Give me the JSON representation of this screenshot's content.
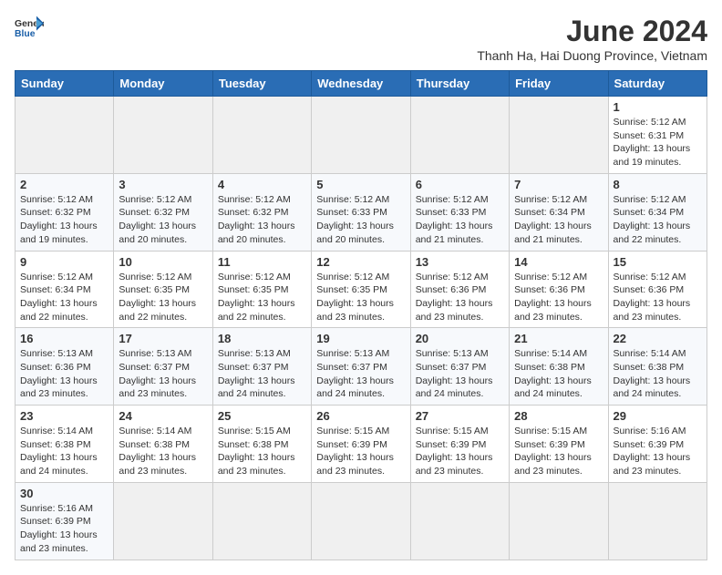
{
  "header": {
    "logo_general": "General",
    "logo_blue": "Blue",
    "month_year": "June 2024",
    "location": "Thanh Ha, Hai Duong Province, Vietnam"
  },
  "days_of_week": [
    "Sunday",
    "Monday",
    "Tuesday",
    "Wednesday",
    "Thursday",
    "Friday",
    "Saturday"
  ],
  "weeks": [
    [
      {
        "day": null,
        "info": ""
      },
      {
        "day": null,
        "info": ""
      },
      {
        "day": null,
        "info": ""
      },
      {
        "day": null,
        "info": ""
      },
      {
        "day": null,
        "info": ""
      },
      {
        "day": null,
        "info": ""
      },
      {
        "day": "1",
        "info": "Sunrise: 5:12 AM\nSunset: 6:31 PM\nDaylight: 13 hours and 19 minutes."
      }
    ],
    [
      {
        "day": "2",
        "info": "Sunrise: 5:12 AM\nSunset: 6:32 PM\nDaylight: 13 hours and 19 minutes."
      },
      {
        "day": "3",
        "info": "Sunrise: 5:12 AM\nSunset: 6:32 PM\nDaylight: 13 hours and 20 minutes."
      },
      {
        "day": "4",
        "info": "Sunrise: 5:12 AM\nSunset: 6:32 PM\nDaylight: 13 hours and 20 minutes."
      },
      {
        "day": "5",
        "info": "Sunrise: 5:12 AM\nSunset: 6:33 PM\nDaylight: 13 hours and 20 minutes."
      },
      {
        "day": "6",
        "info": "Sunrise: 5:12 AM\nSunset: 6:33 PM\nDaylight: 13 hours and 21 minutes."
      },
      {
        "day": "7",
        "info": "Sunrise: 5:12 AM\nSunset: 6:34 PM\nDaylight: 13 hours and 21 minutes."
      },
      {
        "day": "8",
        "info": "Sunrise: 5:12 AM\nSunset: 6:34 PM\nDaylight: 13 hours and 22 minutes."
      }
    ],
    [
      {
        "day": "9",
        "info": "Sunrise: 5:12 AM\nSunset: 6:34 PM\nDaylight: 13 hours and 22 minutes."
      },
      {
        "day": "10",
        "info": "Sunrise: 5:12 AM\nSunset: 6:35 PM\nDaylight: 13 hours and 22 minutes."
      },
      {
        "day": "11",
        "info": "Sunrise: 5:12 AM\nSunset: 6:35 PM\nDaylight: 13 hours and 22 minutes."
      },
      {
        "day": "12",
        "info": "Sunrise: 5:12 AM\nSunset: 6:35 PM\nDaylight: 13 hours and 23 minutes."
      },
      {
        "day": "13",
        "info": "Sunrise: 5:12 AM\nSunset: 6:36 PM\nDaylight: 13 hours and 23 minutes."
      },
      {
        "day": "14",
        "info": "Sunrise: 5:12 AM\nSunset: 6:36 PM\nDaylight: 13 hours and 23 minutes."
      },
      {
        "day": "15",
        "info": "Sunrise: 5:12 AM\nSunset: 6:36 PM\nDaylight: 13 hours and 23 minutes."
      }
    ],
    [
      {
        "day": "16",
        "info": "Sunrise: 5:13 AM\nSunset: 6:36 PM\nDaylight: 13 hours and 23 minutes."
      },
      {
        "day": "17",
        "info": "Sunrise: 5:13 AM\nSunset: 6:37 PM\nDaylight: 13 hours and 23 minutes."
      },
      {
        "day": "18",
        "info": "Sunrise: 5:13 AM\nSunset: 6:37 PM\nDaylight: 13 hours and 24 minutes."
      },
      {
        "day": "19",
        "info": "Sunrise: 5:13 AM\nSunset: 6:37 PM\nDaylight: 13 hours and 24 minutes."
      },
      {
        "day": "20",
        "info": "Sunrise: 5:13 AM\nSunset: 6:37 PM\nDaylight: 13 hours and 24 minutes."
      },
      {
        "day": "21",
        "info": "Sunrise: 5:14 AM\nSunset: 6:38 PM\nDaylight: 13 hours and 24 minutes."
      },
      {
        "day": "22",
        "info": "Sunrise: 5:14 AM\nSunset: 6:38 PM\nDaylight: 13 hours and 24 minutes."
      }
    ],
    [
      {
        "day": "23",
        "info": "Sunrise: 5:14 AM\nSunset: 6:38 PM\nDaylight: 13 hours and 24 minutes."
      },
      {
        "day": "24",
        "info": "Sunrise: 5:14 AM\nSunset: 6:38 PM\nDaylight: 13 hours and 23 minutes."
      },
      {
        "day": "25",
        "info": "Sunrise: 5:15 AM\nSunset: 6:38 PM\nDaylight: 13 hours and 23 minutes."
      },
      {
        "day": "26",
        "info": "Sunrise: 5:15 AM\nSunset: 6:39 PM\nDaylight: 13 hours and 23 minutes."
      },
      {
        "day": "27",
        "info": "Sunrise: 5:15 AM\nSunset: 6:39 PM\nDaylight: 13 hours and 23 minutes."
      },
      {
        "day": "28",
        "info": "Sunrise: 5:15 AM\nSunset: 6:39 PM\nDaylight: 13 hours and 23 minutes."
      },
      {
        "day": "29",
        "info": "Sunrise: 5:16 AM\nSunset: 6:39 PM\nDaylight: 13 hours and 23 minutes."
      }
    ],
    [
      {
        "day": "30",
        "info": "Sunrise: 5:16 AM\nSunset: 6:39 PM\nDaylight: 13 hours and 23 minutes."
      },
      {
        "day": null,
        "info": ""
      },
      {
        "day": null,
        "info": ""
      },
      {
        "day": null,
        "info": ""
      },
      {
        "day": null,
        "info": ""
      },
      {
        "day": null,
        "info": ""
      },
      {
        "day": null,
        "info": ""
      }
    ]
  ]
}
